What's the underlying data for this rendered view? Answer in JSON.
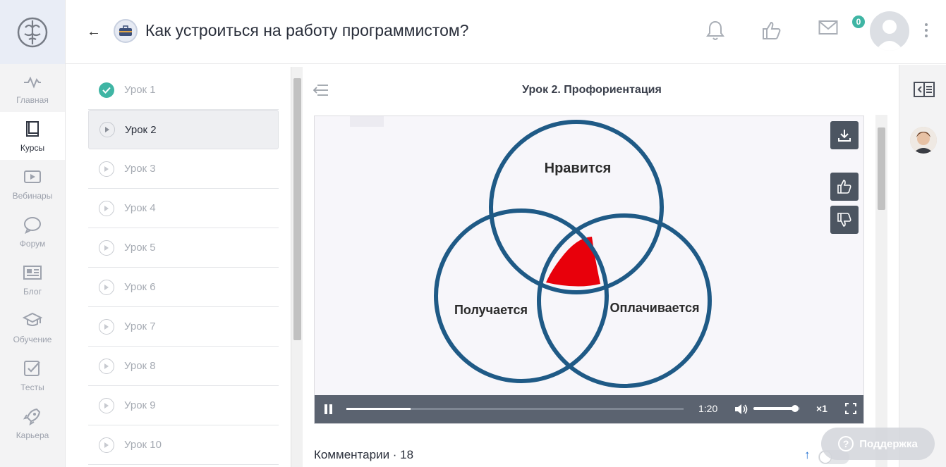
{
  "header": {
    "title": "Как устроиться на работу программистом?",
    "likes_badge": "0"
  },
  "nav": {
    "items": [
      {
        "label": "Главная",
        "icon": "pulse-icon"
      },
      {
        "label": "Курсы",
        "icon": "book-icon",
        "active": true
      },
      {
        "label": "Вебинары",
        "icon": "video-icon"
      },
      {
        "label": "Форум",
        "icon": "chat-icon"
      },
      {
        "label": "Блог",
        "icon": "newspaper-icon"
      },
      {
        "label": "Обучение",
        "icon": "graduation-cap-icon"
      },
      {
        "label": "Тесты",
        "icon": "checkbox-icon"
      },
      {
        "label": "Карьера",
        "icon": "rocket-icon"
      }
    ]
  },
  "lessons": [
    {
      "label": "Урок 1",
      "status": "done"
    },
    {
      "label": "Урок 2",
      "status": "active"
    },
    {
      "label": "Урок 3",
      "status": "pending"
    },
    {
      "label": "Урок 4",
      "status": "pending"
    },
    {
      "label": "Урок 5",
      "status": "pending"
    },
    {
      "label": "Урок 6",
      "status": "pending"
    },
    {
      "label": "Урок 7",
      "status": "pending"
    },
    {
      "label": "Урок 8",
      "status": "pending"
    },
    {
      "label": "Урок 9",
      "status": "pending"
    },
    {
      "label": "Урок 10",
      "status": "pending"
    }
  ],
  "main": {
    "lesson_title": "Урок 2. Профориентация",
    "video": {
      "diagram_labels": {
        "top": "Нравится",
        "left": "Получается",
        "right": "Оплачивается"
      },
      "time": "1:20",
      "speed": "×1",
      "progress": 0.19,
      "volume": 0.9
    },
    "comments_label": "Комментарии · 18"
  },
  "support_label": "Поддержка",
  "colors": {
    "accent": "#3fb5a4",
    "circle": "#1f5a86",
    "highlight": "#e8000b",
    "controls": "#5b6370"
  }
}
